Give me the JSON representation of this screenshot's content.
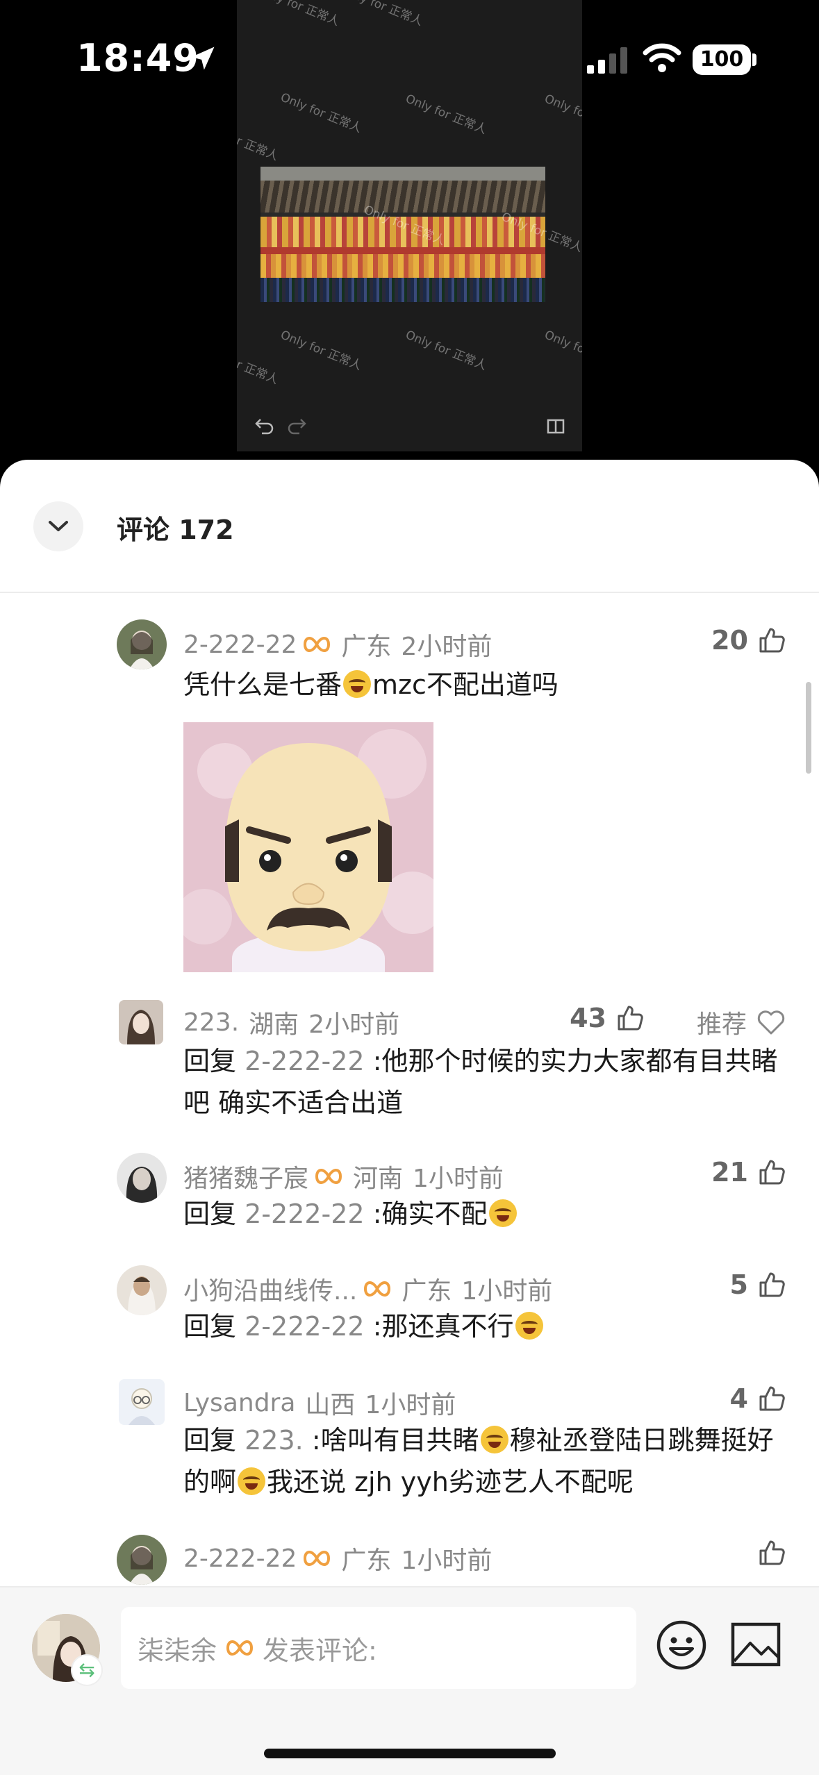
{
  "status_bar": {
    "time": "18:49",
    "battery": "100"
  },
  "video": {
    "watermark_text": "Only for 正常人"
  },
  "comments_sheet": {
    "title": "评论 172",
    "comments": [
      {
        "name": "2-222-22",
        "location": "广东",
        "time": "2小时前",
        "likes": "20",
        "text_parts": [
          "凭什么是七番",
          "mzc不配出道吗"
        ]
      },
      {
        "name": "223.",
        "location": "湖南",
        "time": "2小时前",
        "likes": "43",
        "recommend": "推荐",
        "reply_prefix": "回复",
        "reply_to": "2-222-22",
        "text": ":他那个时候的实力大家都有目共睹吧 确实不适合出道"
      },
      {
        "name": "猪猪魏子宸",
        "location": "河南",
        "time": "1小时前",
        "likes": "21",
        "reply_prefix": "回复",
        "reply_to": "2-222-22",
        "text": ":确实不配"
      },
      {
        "name": "小狗沿曲线传...",
        "location": "广东",
        "time": "1小时前",
        "likes": "5",
        "reply_prefix": "回复",
        "reply_to": "2-222-22",
        "text": ":那还真不行"
      },
      {
        "name": "Lysandra",
        "location": "山西",
        "time": "1小时前",
        "likes": "4",
        "reply_prefix": "回复",
        "reply_to": "223.",
        "text_parts": [
          ":啥叫有目共睹",
          "穆祉丞登陆日跳舞挺好的啊",
          "我还说 zjh yyh劣迹艺人不配呢"
        ]
      },
      {
        "name": "2-222-22",
        "location": "广东",
        "time": "1小时前"
      }
    ]
  },
  "input_bar": {
    "user_name": "柒柒余",
    "placeholder": "发表评论:"
  },
  "colors": {
    "badge_orange": "#f0a040",
    "text_gray": "#888888",
    "text_dark": "#1a1a1a"
  }
}
